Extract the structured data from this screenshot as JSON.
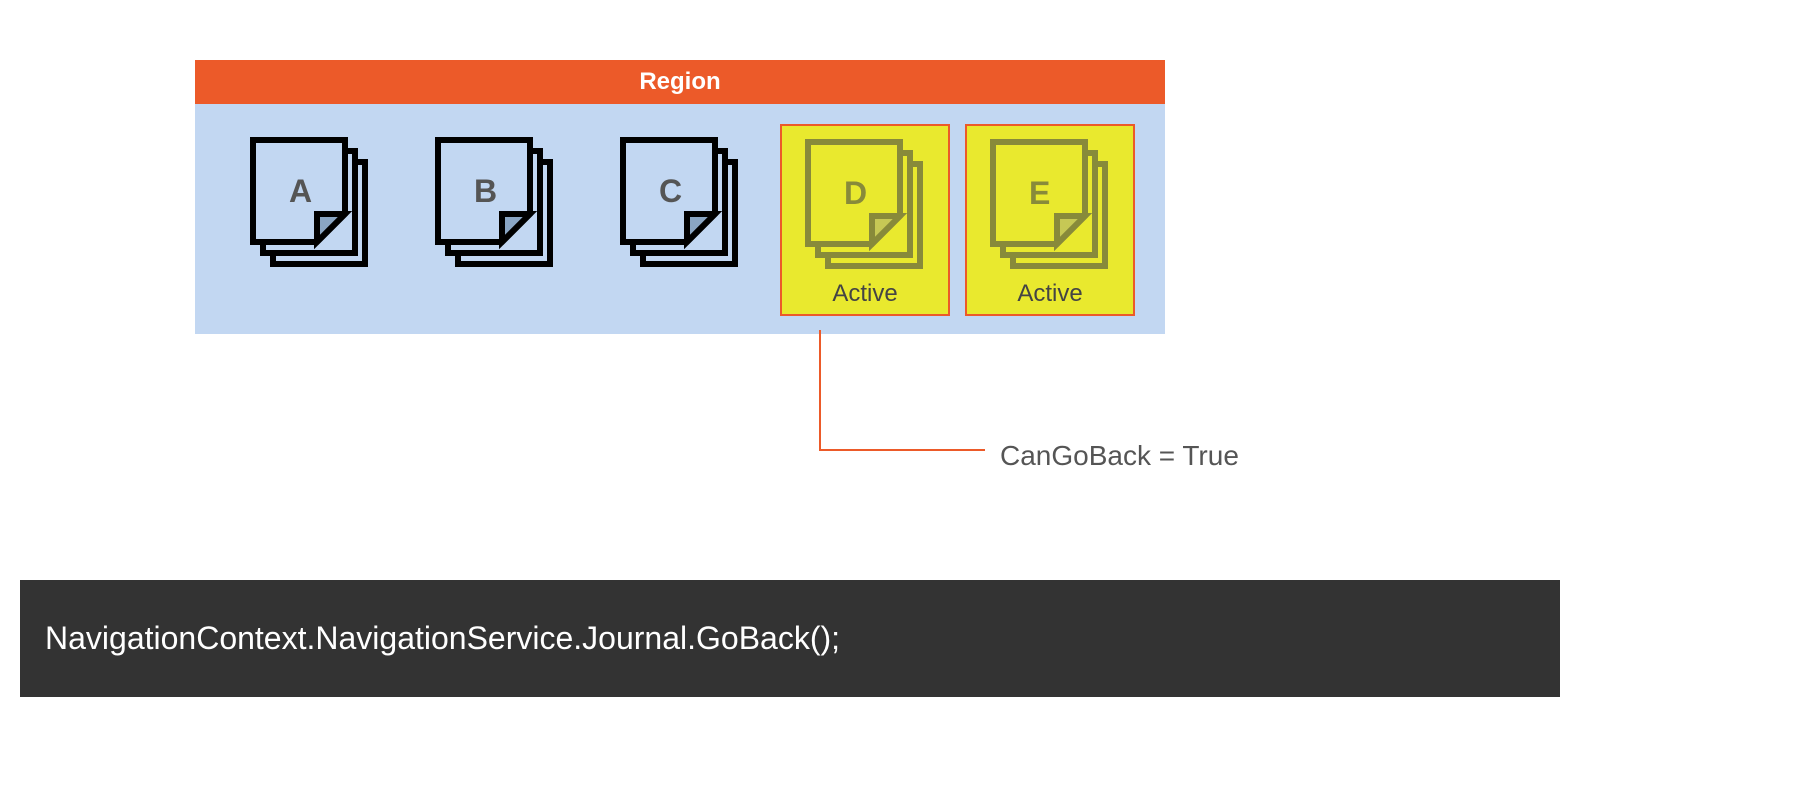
{
  "region": {
    "title": "Region",
    "docs": [
      {
        "letter": "A",
        "active": false
      },
      {
        "letter": "B",
        "active": false
      },
      {
        "letter": "C",
        "active": false
      },
      {
        "letter": "D",
        "active": true,
        "status": "Active"
      },
      {
        "letter": "E",
        "active": true,
        "status": "Active"
      }
    ]
  },
  "callout": "CanGoBack = True",
  "code": "NavigationContext.NavigationService.Journal.GoBack();"
}
